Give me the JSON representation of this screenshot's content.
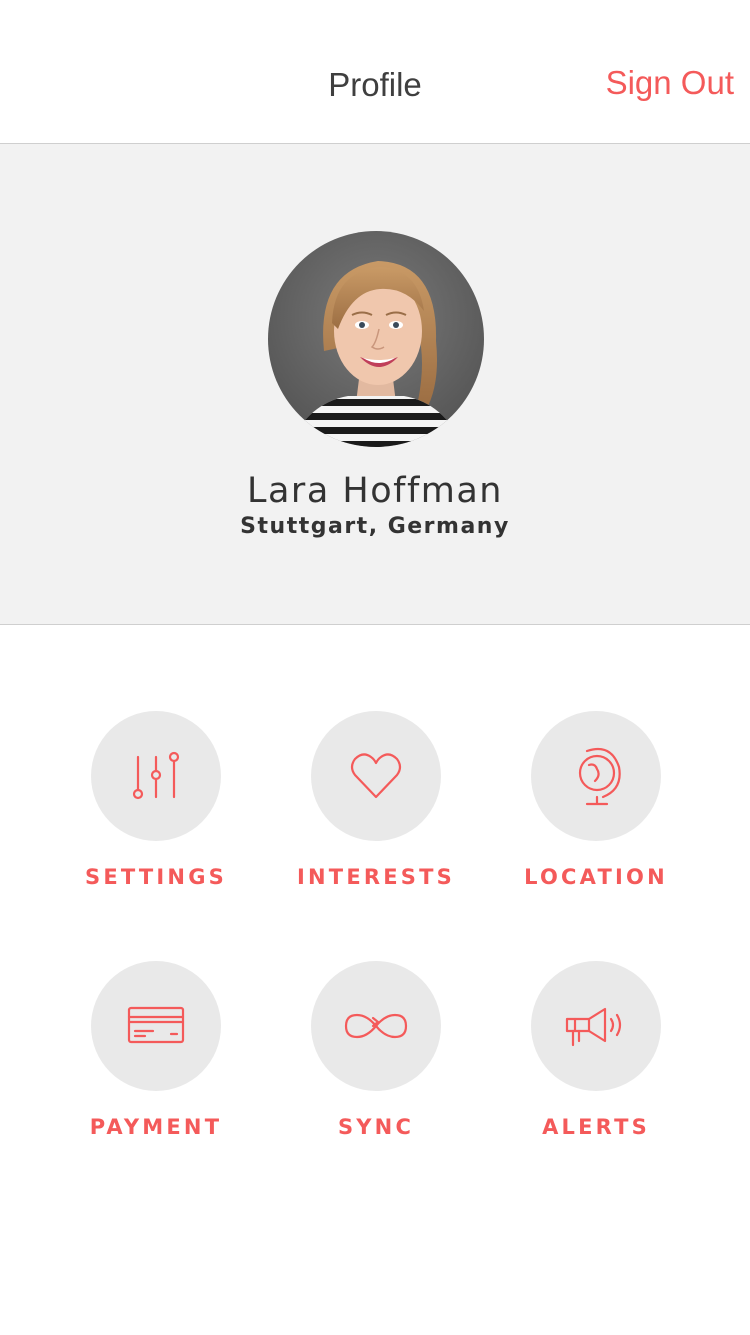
{
  "header": {
    "title": "Profile",
    "sign_out_label": "Sign Out"
  },
  "profile": {
    "name": "Lara Hoffman",
    "location": "Stuttgart, Germany"
  },
  "menu": {
    "items": [
      {
        "label": "SETTINGS",
        "icon": "sliders-icon"
      },
      {
        "label": "INTERESTS",
        "icon": "heart-icon"
      },
      {
        "label": "LOCATION",
        "icon": "globe-icon"
      },
      {
        "label": "PAYMENT",
        "icon": "credit-card-icon"
      },
      {
        "label": "SYNC",
        "icon": "infinity-icon"
      },
      {
        "label": "ALERTS",
        "icon": "megaphone-icon"
      }
    ]
  },
  "colors": {
    "accent": "#f45a5a",
    "panel_background": "#f2f2f2",
    "icon_circle": "#e9e9e9",
    "text": "#333333"
  }
}
